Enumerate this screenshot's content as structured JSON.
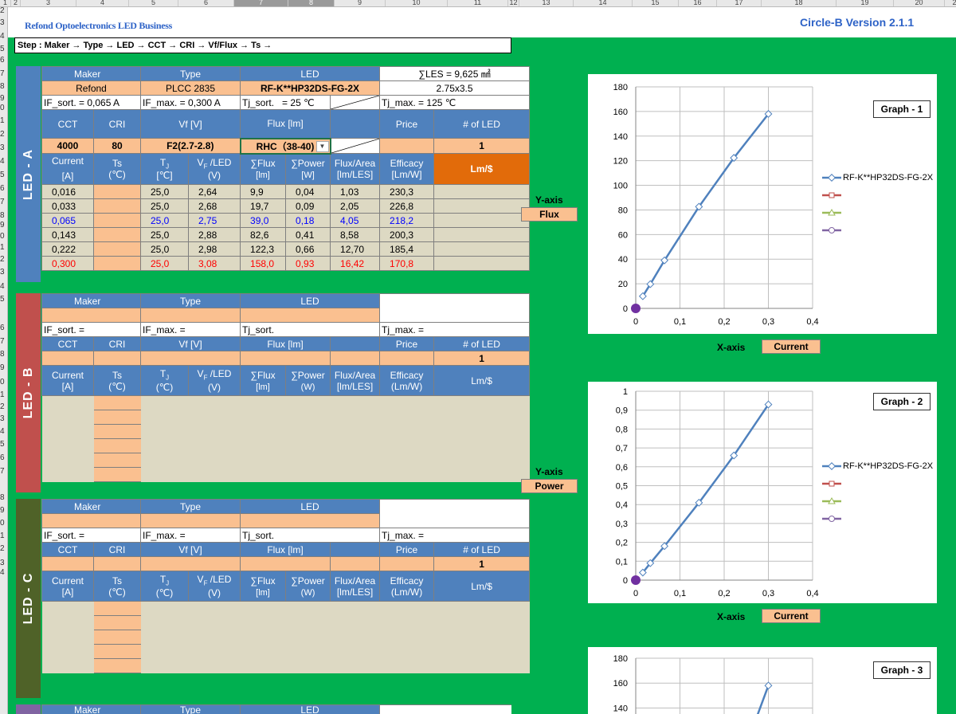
{
  "excel": {
    "columns": [
      "1",
      "2",
      "3",
      "4",
      "5",
      "6",
      "7",
      "8",
      "9",
      "10",
      "11",
      "12",
      "13",
      "14",
      "15",
      "16",
      "17",
      "18",
      "19",
      "20",
      "23"
    ],
    "rows": [
      "2",
      "3",
      "4",
      "5",
      "6",
      "7",
      "8",
      "9",
      "0",
      "1",
      "2",
      "3",
      "4",
      "5",
      "6",
      "7",
      "8",
      "9",
      "0",
      "1",
      "2",
      "3",
      "4",
      "5",
      "6",
      "7",
      "8",
      "9",
      "0",
      "1",
      "2",
      "3",
      "4",
      "5",
      "6",
      "7",
      "8",
      "9",
      "0",
      "1",
      "2",
      "3",
      "4"
    ]
  },
  "app": {
    "title": "Refond Optoelectronics LED Business",
    "version": "Circle-B Version 2.1.1",
    "steps": "Step : Maker → Type → LED → CCT → CRI → Vf/Flux → Ts →"
  },
  "ledA": {
    "side_label": "LED - A",
    "hdr_maker": "Maker",
    "hdr_type": "Type",
    "hdr_led": "LED",
    "les": "∑LES = 9,625 ㎟",
    "maker": "Refond",
    "type": "PLCC 2835",
    "led": "RF-K**HP32DS-FG-2X",
    "size": "2.75x3.5",
    "if_sort": "IF_sort. = 0,065 A",
    "if_max": "IF_max. = 0,300 A",
    "tj_sort": "Tj_sort.",
    "tj_sort_val": "= 25 ℃",
    "tj_max": "Tj_max. = 125 ℃",
    "h_cct": "CCT",
    "h_cri": "CRI",
    "h_vf": "Vf [V]",
    "h_flux": "Flux [lm]",
    "h_price": "Price",
    "h_num": "# of LED",
    "cct": "4000",
    "cri": "80",
    "vf": "F2(2.7-2.8)",
    "flux": "RHC（38-40)",
    "num": "1",
    "c_current": "Current",
    "c_current_u": "[A]",
    "c_ts": "Ts",
    "c_ts_u": "(℃)",
    "c_tj": "T",
    "c_tj_sub": "J",
    "c_tj_u": "[℃]",
    "c_vf": "V",
    "c_vf_sub": "F",
    "c_vf_2": " /LED",
    "c_vf_u": "(V)",
    "c_flux": "∑Flux",
    "c_flux_u": "[lm]",
    "c_power": "∑Power",
    "c_power_u": "[W]",
    "c_fa": "Flux/Area",
    "c_fa_u": "[lm/LES]",
    "c_eff": "Efficacy",
    "c_eff_u": "[Lm/W]",
    "c_lm": "Lm/$",
    "rows": [
      {
        "i": "0,016",
        "tj": "25,0",
        "vf": "2,64",
        "flux": "9,9",
        "p": "0,04",
        "fa": "1,03",
        "eff": "230,3"
      },
      {
        "i": "0,033",
        "tj": "25,0",
        "vf": "2,68",
        "flux": "19,7",
        "p": "0,09",
        "fa": "2,05",
        "eff": "226,8"
      },
      {
        "i": "0,065",
        "tj": "25,0",
        "vf": "2,75",
        "flux": "39,0",
        "p": "0,18",
        "fa": "4,05",
        "eff": "218,2"
      },
      {
        "i": "0,143",
        "tj": "25,0",
        "vf": "2,88",
        "flux": "82,6",
        "p": "0,41",
        "fa": "8,58",
        "eff": "200,3"
      },
      {
        "i": "0,222",
        "tj": "25,0",
        "vf": "2,98",
        "flux": "122,3",
        "p": "0,66",
        "fa": "12,70",
        "eff": "185,4"
      },
      {
        "i": "0,300",
        "tj": "25,0",
        "vf": "3,08",
        "flux": "158,0",
        "p": "0,93",
        "fa": "16,42",
        "eff": "170,8"
      }
    ]
  },
  "ledB": {
    "side_label": "LED - B",
    "hdr_maker": "Maker",
    "hdr_type": "Type",
    "hdr_led": "LED",
    "if_sort": "IF_sort. =",
    "if_max": "IF_max. =",
    "tj_sort": "Tj_sort.",
    "tj_max": "Tj_max. =",
    "h_cct": "CCT",
    "h_cri": "CRI",
    "h_vf": "Vf [V]",
    "h_flux": "Flux [lm]",
    "h_price": "Price",
    "h_num": "# of LED",
    "num": "1",
    "c_current": "Current",
    "c_current_u": "[A]",
    "c_ts": "Ts",
    "c_ts_u": "(℃)",
    "c_tj": "T",
    "c_tj_sub": "J",
    "c_tj_u": "(℃)",
    "c_vf": "V",
    "c_vf_sub": "F",
    "c_vf_2": " /LED",
    "c_vf_u": "(V)",
    "c_flux": "∑Flux",
    "c_flux_u": "[lm]",
    "c_power": "∑Power",
    "c_power_u": "(W)",
    "c_fa": "Flux/Area",
    "c_fa_u": "[lm/LES]",
    "c_eff": "Efficacy",
    "c_eff_u": "(Lm/W)",
    "c_lm": "Lm/$"
  },
  "ledC": {
    "side_label": "LED - C",
    "hdr_maker": "Maker",
    "hdr_type": "Type",
    "hdr_led": "LED",
    "if_sort": "IF_sort. =",
    "if_max": "IF_max. =",
    "tj_sort": "Tj_sort.",
    "tj_max": "Tj_max. =",
    "h_cct": "CCT",
    "h_cri": "CRI",
    "h_vf": "Vf [V]",
    "h_flux": "Flux [lm]",
    "h_price": "Price",
    "h_num": "# of LED",
    "num": "1",
    "c_current": "Current",
    "c_current_u": "[A]",
    "c_ts": "Ts",
    "c_ts_u": "(℃)",
    "c_tj": "T",
    "c_tj_sub": "J",
    "c_tj_u": "(℃)",
    "c_vf": "V",
    "c_vf_sub": "F",
    "c_vf_2": " /LED",
    "c_vf_u": "(V)",
    "c_flux": "∑Flux",
    "c_flux_u": "[lm]",
    "c_power": "∑Power",
    "c_power_u": "(W)",
    "c_fa": "Flux/Area",
    "c_fa_u": "[lm/LES]",
    "c_eff": "Efficacy",
    "c_eff_u": "(Lm/W)",
    "c_lm": "Lm/$"
  },
  "ledD": {
    "hdr_maker": "Maker",
    "hdr_type": "Type",
    "hdr_led": "LED"
  },
  "graph1": {
    "label": "Graph - 1",
    "yaxis": "Y-axis",
    "yval": "Flux",
    "xaxis": "X-axis",
    "xval": "Current",
    "legend": [
      "RF-K**HP32DS-FG-2X",
      "",
      "",
      ""
    ]
  },
  "graph2": {
    "label": "Graph - 2",
    "yaxis": "Y-axis",
    "yval": "Power",
    "xaxis": "X-axis",
    "xval": "Current",
    "legend": [
      "RF-K**HP32DS-FG-2X",
      "",
      "",
      ""
    ]
  },
  "graph3": {
    "label": "Graph - 3"
  },
  "colors": {
    "series1": "#4f81bd",
    "series2": "#c0504d",
    "series3": "#9bbb59",
    "series4": "#8064a2",
    "origin": "#7030a0"
  },
  "chart_data": [
    {
      "type": "line",
      "title": "Graph - 1",
      "x": [
        0.016,
        0.033,
        0.065,
        0.143,
        0.222,
        0.3
      ],
      "series": [
        {
          "name": "RF-K**HP32DS-FG-2X",
          "values": [
            9.9,
            19.7,
            39.0,
            82.6,
            122.3,
            158.0
          ]
        }
      ],
      "xlim": [
        0,
        0.4
      ],
      "ylim": [
        0,
        180
      ],
      "xticks": [
        "0",
        "0,1",
        "0,2",
        "0,3",
        "0,4"
      ],
      "yticks": [
        "0",
        "20",
        "40",
        "60",
        "80",
        "100",
        "120",
        "140",
        "160",
        "180"
      ],
      "grid": true,
      "legend": "right"
    },
    {
      "type": "line",
      "title": "Graph - 2",
      "x": [
        0.016,
        0.033,
        0.065,
        0.143,
        0.222,
        0.3
      ],
      "series": [
        {
          "name": "RF-K**HP32DS-FG-2X",
          "values": [
            0.04,
            0.09,
            0.18,
            0.41,
            0.66,
            0.93
          ]
        }
      ],
      "xlim": [
        0,
        0.4
      ],
      "ylim": [
        0,
        1
      ],
      "xticks": [
        "0",
        "0,1",
        "0,2",
        "0,3",
        "0,4"
      ],
      "yticks": [
        "0",
        "0,1",
        "0,2",
        "0,3",
        "0,4",
        "0,5",
        "0,6",
        "0,7",
        "0,8",
        "0,9",
        "1"
      ],
      "grid": true,
      "legend": "right"
    },
    {
      "type": "line",
      "title": "Graph - 3",
      "x": [
        0.3
      ],
      "series": [
        {
          "values": [
            158.0
          ]
        }
      ],
      "ylim": [
        0,
        180
      ],
      "yticks": [
        "140",
        "160",
        "180"
      ],
      "grid": true
    }
  ]
}
